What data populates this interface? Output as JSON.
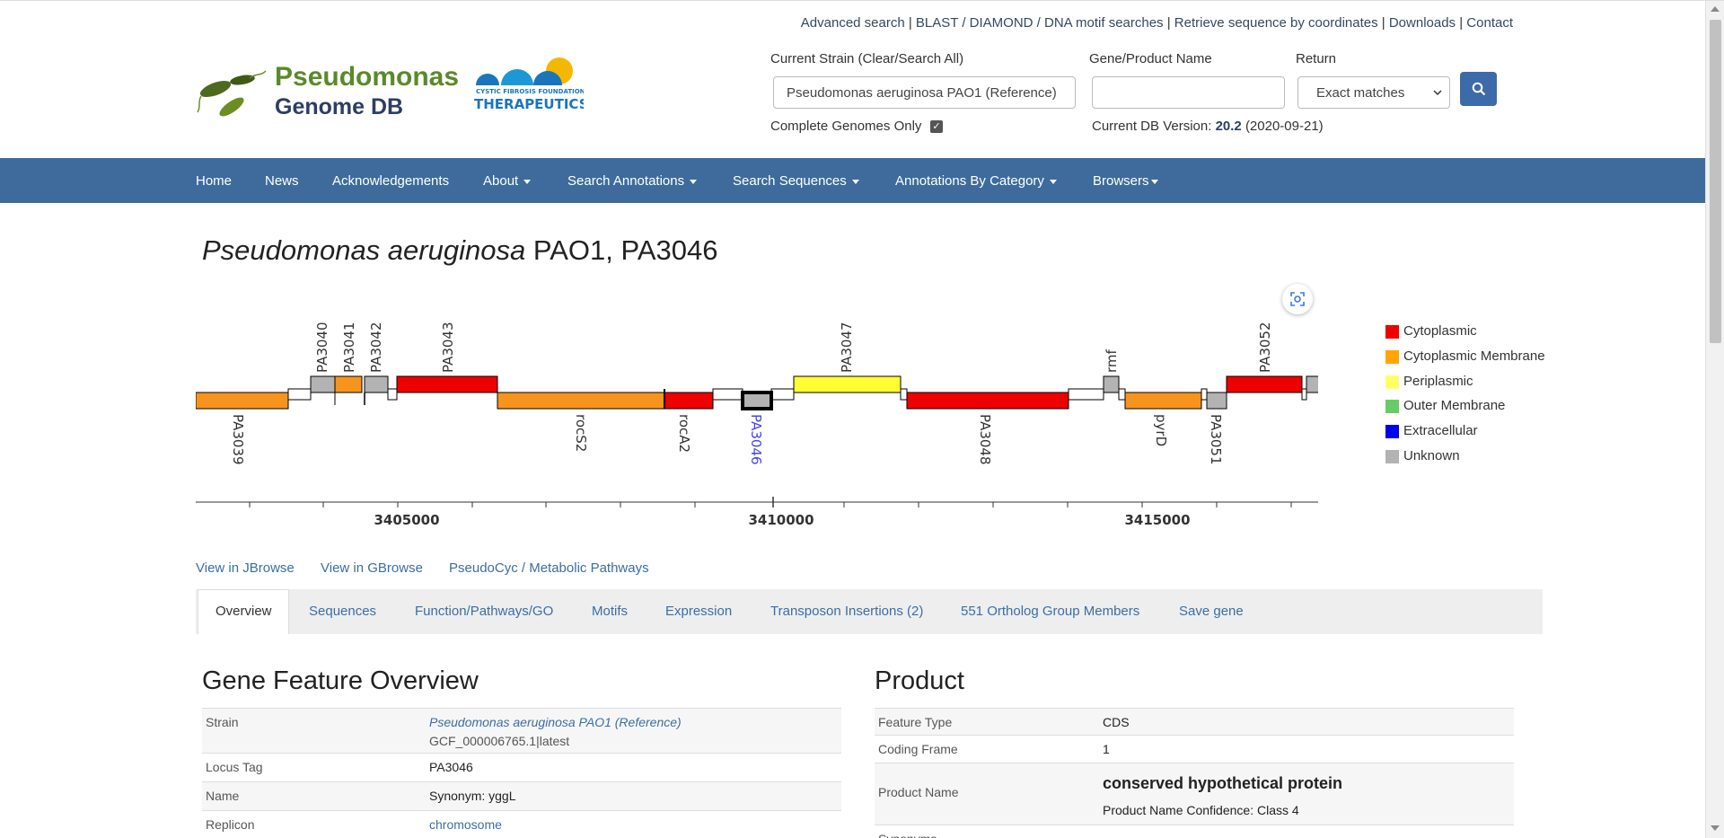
{
  "header": {
    "top_links": [
      "Advanced search",
      "BLAST / DIAMOND / DNA motif searches",
      "Retrieve sequence by coordinates",
      "Downloads",
      "Contact"
    ],
    "logo_line1": "Pseudomonas",
    "logo_line2": "Genome DB",
    "partner_logo_small": "CYSTIC FIBROSIS FOUNDATION",
    "partner_logo_big": "THERAPEUTICS",
    "strain_label": "Current Strain (Clear/Search All)",
    "strain_value": "Pseudomonas aeruginosa PAO1 (Reference)",
    "gene_label": "Gene/Product Name",
    "gene_value": "",
    "return_label": "Return",
    "return_value": "Exact matches",
    "complete_label": "Complete Genomes Only",
    "complete_checked": true,
    "db_version_prefix": "Current DB Version:",
    "db_version": "20.2",
    "db_date": "(2020-09-21)"
  },
  "nav": {
    "items": [
      {
        "label": "Home"
      },
      {
        "label": "News"
      },
      {
        "label": "Acknowledgements"
      },
      {
        "label": "About"
      },
      {
        "label": "Search Annotations"
      },
      {
        "label": "Search Sequences"
      },
      {
        "label": "Annotations By Category"
      },
      {
        "label": "Browsers"
      }
    ]
  },
  "title": {
    "species": "Pseudomonas aeruginosa",
    "rest": "PAO1, PA3046"
  },
  "genome_map": {
    "axis_ticks": [
      "3405000",
      "3410000",
      "3415000"
    ],
    "genes_top": [
      {
        "name": "PA3040",
        "color": "#b3b3b3"
      },
      {
        "name": "PA3041",
        "color": "#f7941d"
      },
      {
        "name": "PA3042",
        "color": "#b3b3b3"
      },
      {
        "name": "PA3043",
        "color": "#ee0000"
      },
      {
        "name": "PA3047",
        "color": "#ffff33"
      },
      {
        "name": "rmf",
        "color": "#b3b3b3"
      },
      {
        "name": "PA3052",
        "color": "#ee0000"
      }
    ],
    "genes_bottom": [
      {
        "name": "PA3039",
        "color": "#f7941d"
      },
      {
        "name": "rocS2",
        "color": "#f7941d"
      },
      {
        "name": "rocA2",
        "color": "#ee0000"
      },
      {
        "name": "PA3046",
        "color": "#b3b3b3"
      },
      {
        "name": "PA3048",
        "color": "#ee0000"
      },
      {
        "name": "pyrD",
        "color": "#f7941d"
      },
      {
        "name": "PA3051",
        "color": "#b3b3b3"
      }
    ],
    "legend": [
      {
        "label": "Cytoplasmic",
        "color": "#ee0000"
      },
      {
        "label": "Cytoplasmic Membrane",
        "color": "#ffa500"
      },
      {
        "label": "Periplasmic",
        "color": "#ffff66"
      },
      {
        "label": "Outer Membrane",
        "color": "#66cc66"
      },
      {
        "label": "Extracellular",
        "color": "#0000ee"
      },
      {
        "label": "Unknown",
        "color": "#b3b3b3"
      }
    ]
  },
  "links": [
    "View in JBrowse",
    "View in GBrowse",
    "PseudoCyc / Metabolic Pathways"
  ],
  "tabs": [
    "Overview",
    "Sequences",
    "Function/Pathways/GO",
    "Motifs",
    "Expression",
    "Transposon Insertions (2)",
    "551 Ortholog Group Members",
    "Save gene"
  ],
  "overview": {
    "title": "Gene Feature Overview",
    "rows": [
      {
        "key": "Strain",
        "value": "Pseudomonas aeruginosa PAO1 (Reference)",
        "sub": "GCF_000006765.1|latest"
      },
      {
        "key": "Locus Tag",
        "value": "PA3046"
      },
      {
        "key": "Name",
        "value": "Synonym: yggL"
      },
      {
        "key": "Replicon",
        "value": "chromosome"
      }
    ]
  },
  "product": {
    "title": "Product",
    "rows": [
      {
        "key": "Feature Type",
        "value": "CDS"
      },
      {
        "key": "Coding Frame",
        "value": "1"
      },
      {
        "key": "Product Name",
        "value": "conserved hypothetical protein",
        "sub": "Product Name Confidence: Class 4"
      },
      {
        "key": "Synonyms",
        "value": ""
      }
    ]
  }
}
